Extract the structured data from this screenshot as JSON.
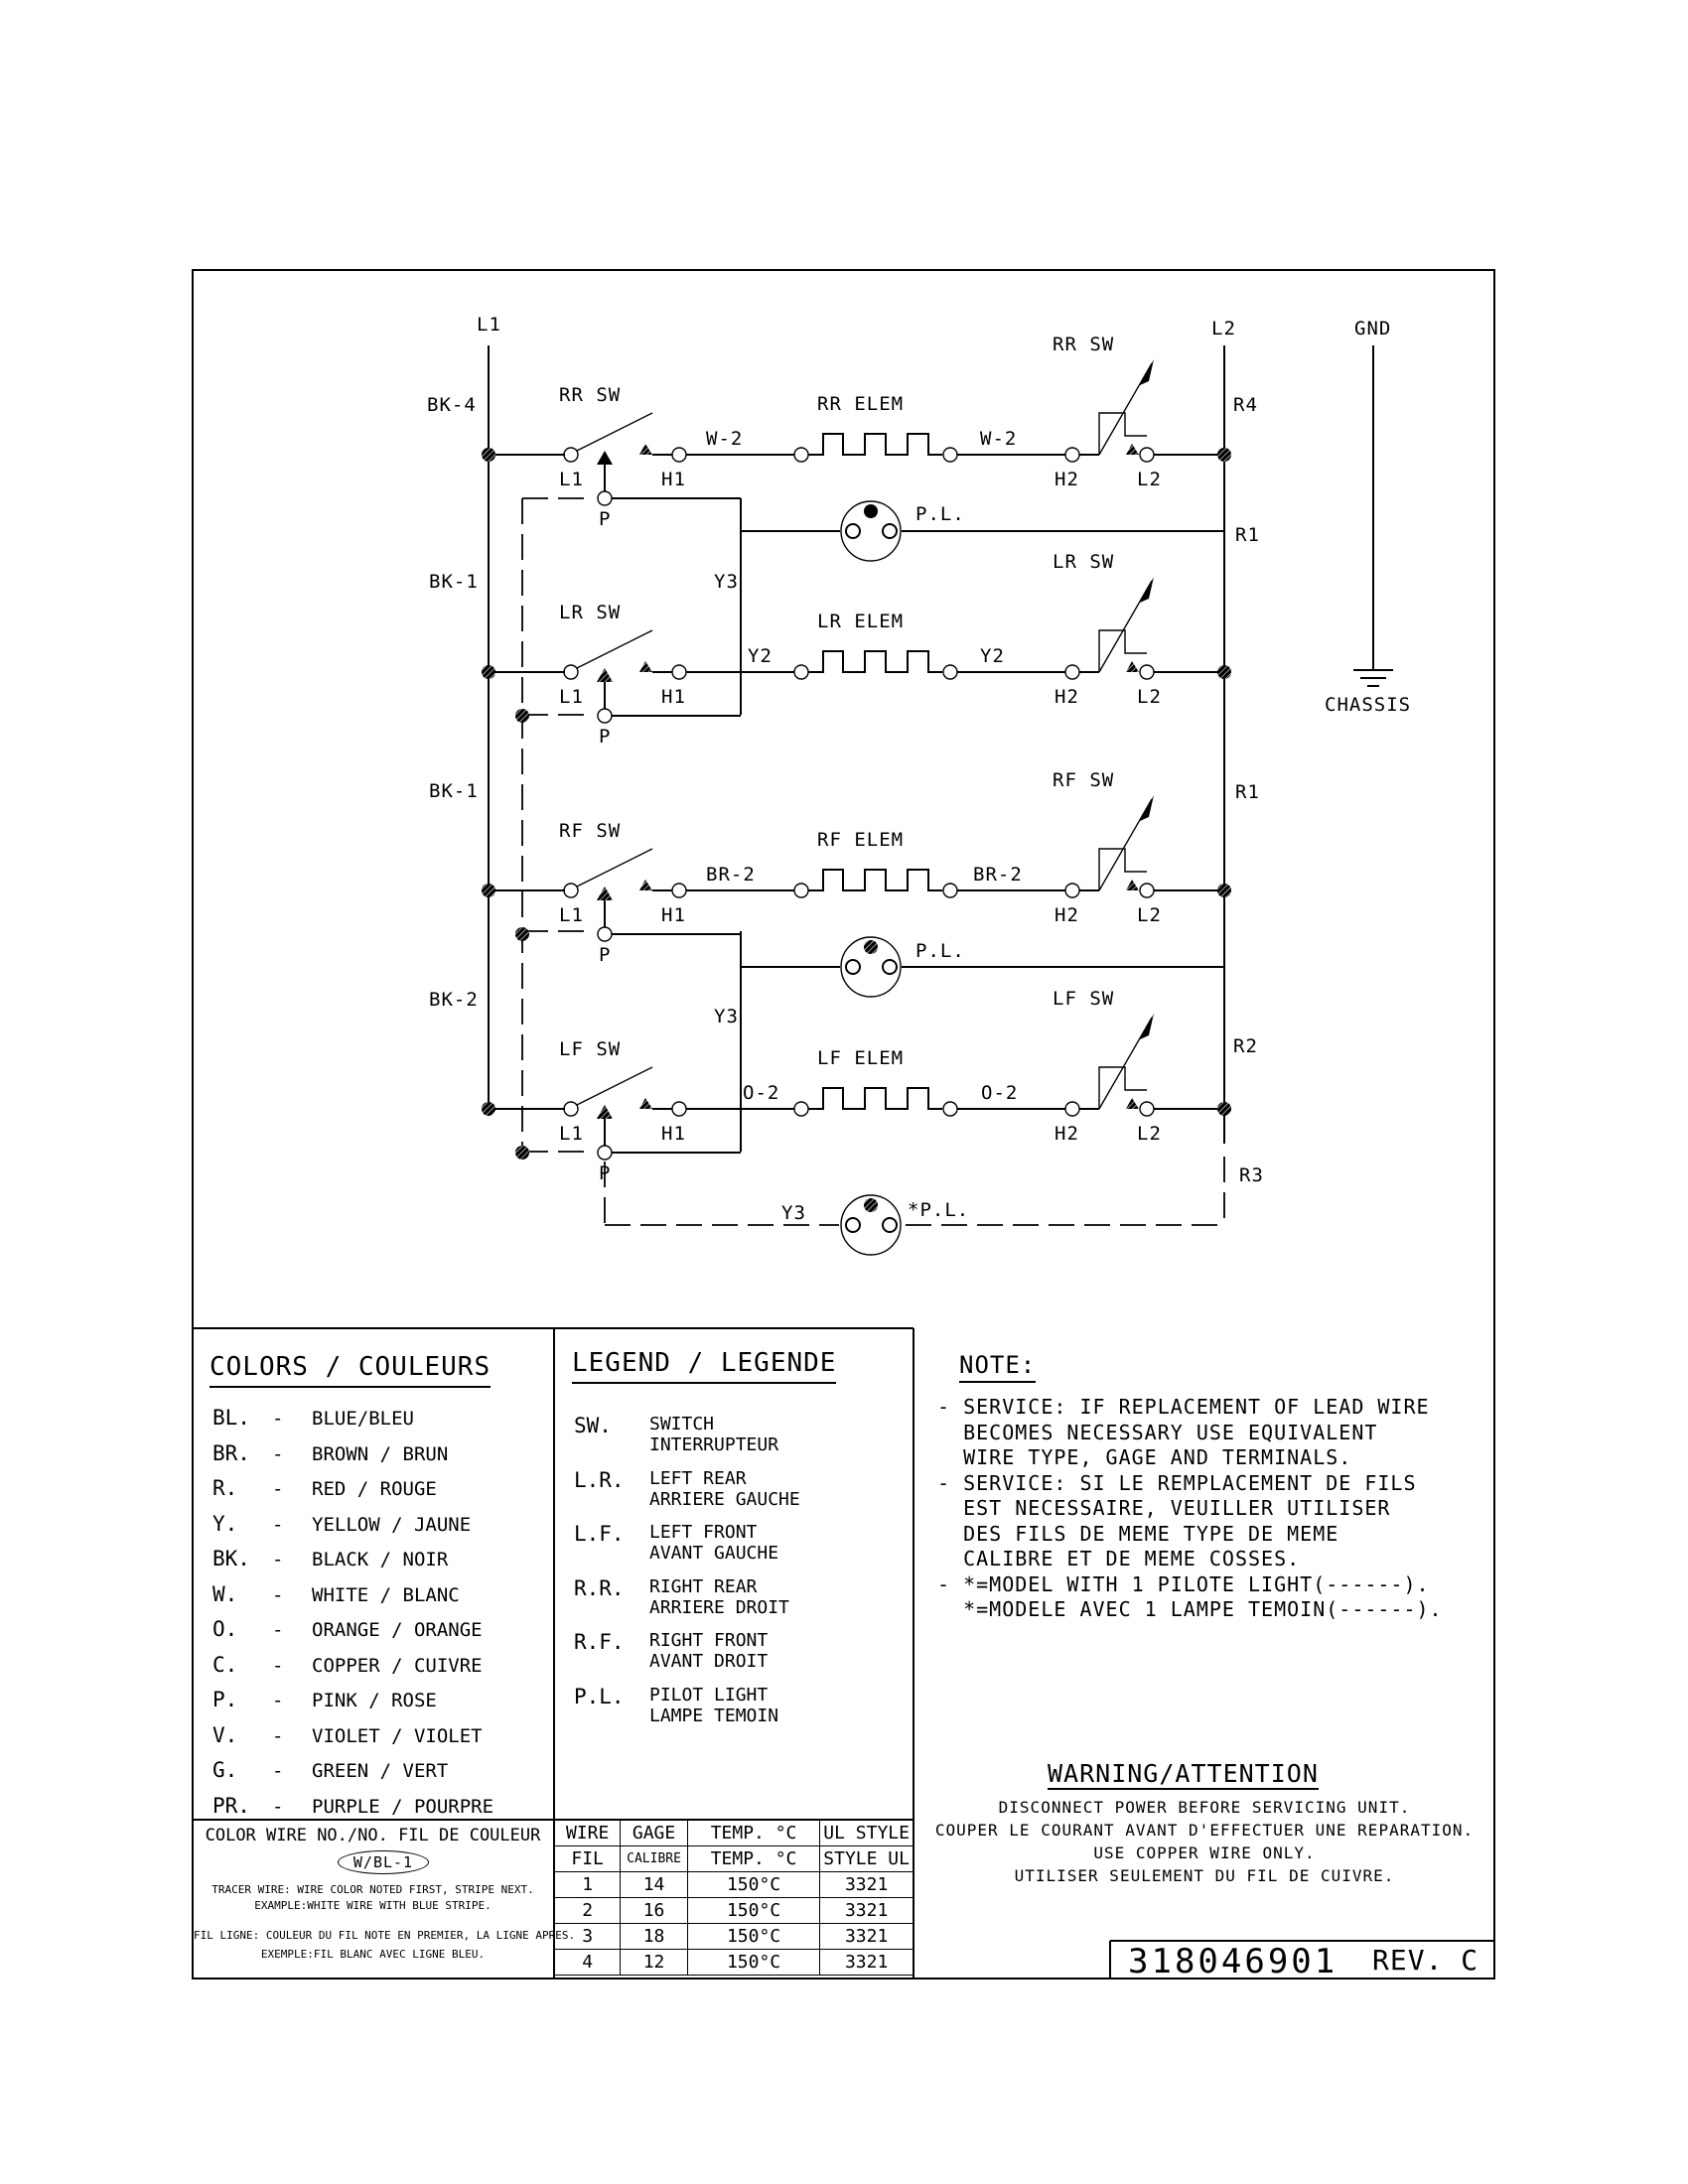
{
  "schematic": {
    "rails": {
      "l1": "L1",
      "l2": "L2",
      "gnd": "GND",
      "chassis": "CHASSIS"
    },
    "left_wire_labels": [
      "BK-4",
      "BK-1",
      "BK-1",
      "BK-2"
    ],
    "right_wire_labels": [
      "R4",
      "R1",
      "R1",
      "R2",
      "R3"
    ],
    "circuits": [
      {
        "switch": "RR SW",
        "element": "RR ELEM",
        "wire": "W-2",
        "t_l1": "L1",
        "t_h1": "H1",
        "t_h2": "H2",
        "t_l2": "L2",
        "t_p": "P",
        "pilot": "P.L.",
        "pilot_wire": "Y3"
      },
      {
        "switch": "LR SW",
        "element": "LR ELEM",
        "wire": "Y2",
        "t_l1": "L1",
        "t_h1": "H1",
        "t_h2": "H2",
        "t_l2": "L2",
        "t_p": "P"
      },
      {
        "switch": "RF SW",
        "element": "RF ELEM",
        "wire": "BR-2",
        "t_l1": "L1",
        "t_h1": "H1",
        "t_h2": "H2",
        "t_l2": "L2",
        "t_p": "P",
        "pilot": "P.L.",
        "pilot_wire": "Y3"
      },
      {
        "switch": "LF SW",
        "element": "LF ELEM",
        "wire": "O-2",
        "t_l1": "L1",
        "t_h1": "H1",
        "t_h2": "H2",
        "t_l2": "L2",
        "t_p": "P"
      }
    ],
    "optional_pilot": {
      "label": "*P.L.",
      "wire": "Y3"
    }
  },
  "colors": {
    "title": "COLORS / COULEURS",
    "items": [
      {
        "code": "BL.",
        "name": "BLUE/BLEU"
      },
      {
        "code": "BR.",
        "name": "BROWN / BRUN"
      },
      {
        "code": "R.",
        "name": "RED / ROUGE"
      },
      {
        "code": "Y.",
        "name": "YELLOW / JAUNE"
      },
      {
        "code": "BK.",
        "name": "BLACK / NOIR"
      },
      {
        "code": "W.",
        "name": "WHITE / BLANC"
      },
      {
        "code": "O.",
        "name": "ORANGE / ORANGE"
      },
      {
        "code": "C.",
        "name": "COPPER / CUIVRE"
      },
      {
        "code": "P.",
        "name": "PINK / ROSE"
      },
      {
        "code": "V.",
        "name": "VIOLET / VIOLET"
      },
      {
        "code": "G.",
        "name": "GREEN / VERT"
      },
      {
        "code": "PR.",
        "name": "PURPLE / POURPRE"
      }
    ]
  },
  "legend": {
    "title": "LEGEND / LEGENDE",
    "items": [
      {
        "abbr": "SW.",
        "en": "SWITCH",
        "fr": "INTERRUPTEUR"
      },
      {
        "abbr": "L.R.",
        "en": "LEFT REAR",
        "fr": "ARRIERE GAUCHE"
      },
      {
        "abbr": "L.F.",
        "en": "LEFT FRONT",
        "fr": "AVANT GAUCHE"
      },
      {
        "abbr": "R.R.",
        "en": "RIGHT REAR",
        "fr": "ARRIERE DROIT"
      },
      {
        "abbr": "R.F.",
        "en": "RIGHT FRONT",
        "fr": "AVANT DROIT"
      },
      {
        "abbr": "P.L.",
        "en": "PILOT LIGHT",
        "fr": "LAMPE TEMOIN"
      }
    ]
  },
  "note": {
    "title": "NOTE:",
    "lines": [
      "- SERVICE: IF REPLACEMENT OF LEAD WIRE",
      "  BECOMES NECESSARY USE EQUIVALENT",
      "  WIRE TYPE, GAGE AND TERMINALS.",
      "- SERVICE: SI LE REMPLACEMENT DE FILS",
      "  EST NECESSAIRE, VEUILLER UTILISER",
      "  DES FILS DE MEME TYPE DE MEME",
      "  CALIBRE ET DE MEME COSSES.",
      "- *=MODEL WITH 1 PILOTE LIGHT(------).",
      "  *=MODELE AVEC 1 LAMPE TEMOIN(------)."
    ]
  },
  "color_wire": {
    "title": "COLOR WIRE NO./NO. FIL DE COULEUR",
    "example_badge": "W/BL-1",
    "tracer_en_1": "TRACER WIRE: WIRE COLOR NOTED FIRST, STRIPE NEXT.",
    "tracer_en_2": "EXAMPLE:WHITE WIRE WITH BLUE STRIPE.",
    "tracer_fr_1": "FIL LIGNE: COULEUR DU FIL NOTE EN PREMIER, LA LIGNE APRES.",
    "tracer_fr_2": "EXEMPLE:FIL BLANC AVEC LIGNE BLEU."
  },
  "wire_table": {
    "headers_en": [
      "WIRE",
      "GAGE",
      "TEMP.  °C",
      "UL STYLE"
    ],
    "headers_fr": [
      "FIL",
      "CALIBRE",
      "TEMP. °C",
      "STYLE UL"
    ],
    "rows": [
      [
        "1",
        "14",
        "150°C",
        "3321"
      ],
      [
        "2",
        "16",
        "150°C",
        "3321"
      ],
      [
        "3",
        "18",
        "150°C",
        "3321"
      ],
      [
        "4",
        "12",
        "150°C",
        "3321"
      ]
    ]
  },
  "warning": {
    "title": "WARNING/ATTENTION",
    "lines": [
      "DISCONNECT POWER BEFORE SERVICING UNIT.",
      "COUPER LE COURANT AVANT D'EFFECTUER UNE REPARATION.",
      "USE COPPER WIRE ONLY.",
      "UTILISER SEULEMENT DU FIL DE CUIVRE."
    ]
  },
  "title_block": {
    "part_number": "318046901",
    "revision": "REV. C"
  }
}
